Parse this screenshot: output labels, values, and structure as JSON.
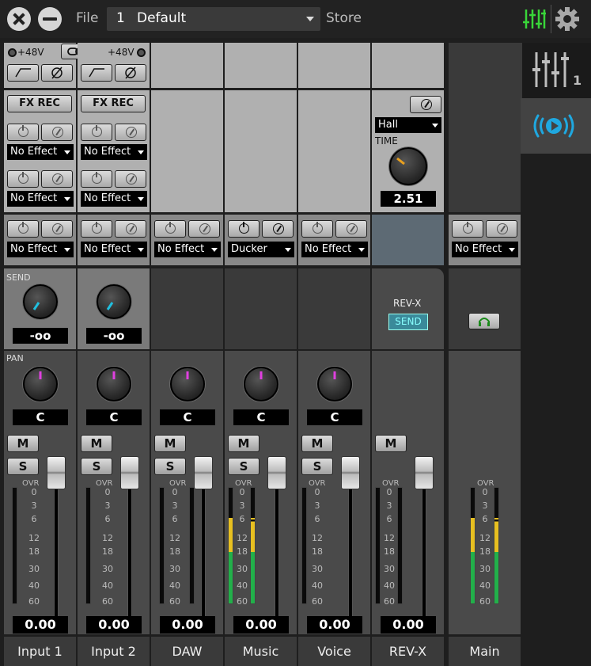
{
  "topbar": {
    "file_label": "File",
    "scene_number": "1",
    "scene_name": "Default",
    "store_label": "Store",
    "accent": "#39d639"
  },
  "tabs": {
    "mixer_number": "1"
  },
  "channels": [
    {
      "name": "Input 1",
      "phantom": "+48V",
      "fx_rec": "FX REC",
      "insert1": "No Effect",
      "insert2": "No Effect",
      "effect": "No Effect",
      "send": "-oo",
      "pan": "C",
      "level": "0.00"
    },
    {
      "name": "Input 2",
      "phantom": "+48V",
      "fx_rec": "FX REC",
      "insert1": "No Effect",
      "insert2": "No Effect",
      "effect": "No Effect",
      "send": "-oo",
      "pan": "C",
      "level": "0.00"
    },
    {
      "name": "DAW",
      "effect": "No Effect",
      "pan": "C",
      "level": "0.00"
    },
    {
      "name": "Music",
      "effect": "Ducker",
      "pan": "C",
      "level": "0.00"
    },
    {
      "name": "Voice",
      "effect": "No Effect",
      "pan": "C",
      "level": "0.00"
    },
    {
      "name": "REV-X",
      "rev_type": "Hall",
      "time_label": "TIME",
      "time_value": "2.51",
      "send_title": "REV-X",
      "send_button": "SEND",
      "level": "0.00"
    },
    {
      "name": "Main",
      "effect": "No Effect"
    }
  ],
  "labels": {
    "send": "SEND",
    "pan": "PAN",
    "mute": "M",
    "solo": "S",
    "ovr": "OVR"
  },
  "meter_scale": [
    "0",
    "3",
    "6",
    "12",
    "18",
    "30",
    "40",
    "60"
  ],
  "colors": {
    "pan_indicator": "#e040e0",
    "send_indicator": "#20c0e0",
    "meter_green": "#22b04a",
    "meter_yellow": "#e8c020",
    "stream_blue": "#1fa8e0"
  }
}
